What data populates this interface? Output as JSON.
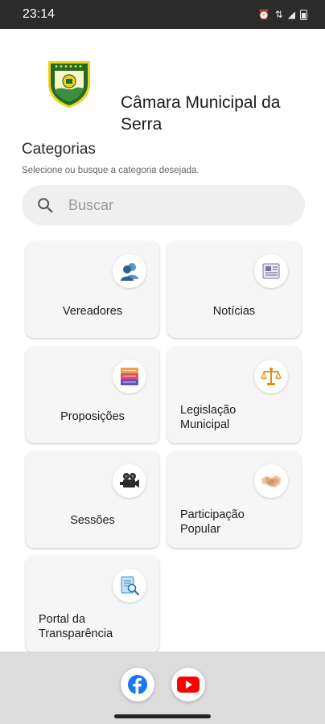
{
  "status_bar": {
    "time": "23:14"
  },
  "header": {
    "title": "Câmara Municipal da Serra"
  },
  "categories": {
    "title": "Categorias",
    "subtitle": "Selecione ou busque a categoria desejada."
  },
  "search": {
    "placeholder": "Buscar"
  },
  "cards": [
    {
      "label": "Vereadores",
      "icon": "people-icon"
    },
    {
      "label": "Notícias",
      "icon": "newspaper-icon"
    },
    {
      "label": "Proposições",
      "icon": "books-icon"
    },
    {
      "label": "Legislação Municipal",
      "icon": "scales-icon"
    },
    {
      "label": "Sessões",
      "icon": "video-camera-icon"
    },
    {
      "label": "Participação Popular",
      "icon": "handshake-icon"
    },
    {
      "label": "Portal da Transparência",
      "icon": "document-search-icon"
    }
  ],
  "social": [
    {
      "name": "facebook-icon",
      "color": "#1877f2"
    },
    {
      "name": "youtube-icon",
      "color": "#ff0000"
    }
  ],
  "colors": {
    "status_bar": "#2b2b2b",
    "card_bg": "#f6f6f6",
    "search_bg": "#efefef",
    "bottom_bar": "#dcdcdc",
    "logo_green": "#1f6b2a",
    "logo_yellow": "#f3d21a"
  }
}
